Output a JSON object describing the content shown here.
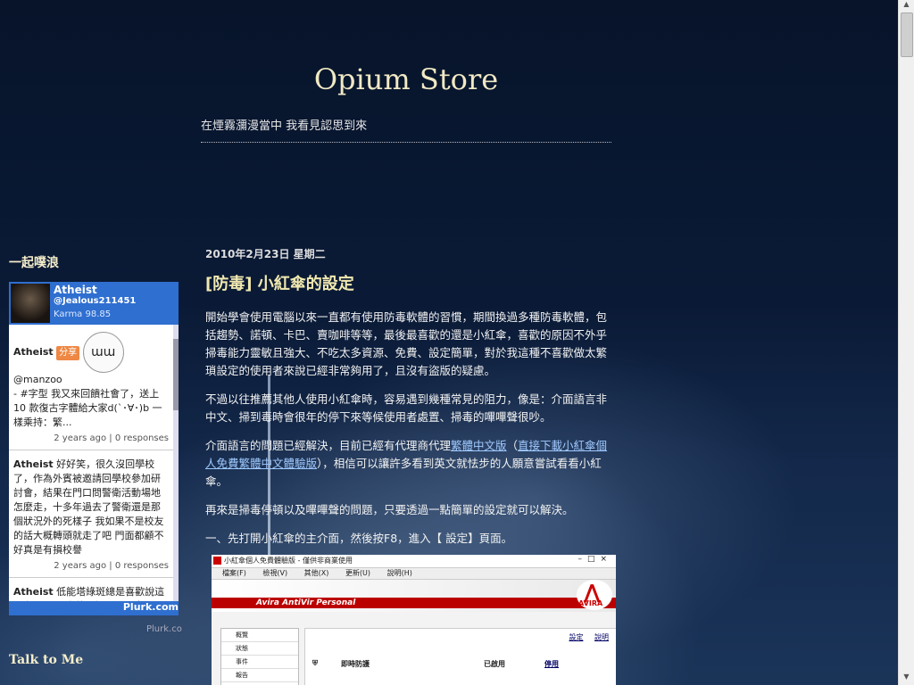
{
  "blog": {
    "title": "Opium Store",
    "description": "在煙霧瀰漫當中 我看見認思到來"
  },
  "sidebar": {
    "plurk_heading": "一起噗浪",
    "talk_heading": "Talk to Me",
    "plurk": {
      "name": "Atheist",
      "handle": "@Jealous211451",
      "karma": "Karma 98.85",
      "footer": "Plurk.com",
      "credit": "Plurk.co",
      "items": [
        {
          "author": "Atheist",
          "share": "分享",
          "mention": "@manzoo",
          "text": "- #字型 我又來回饋社會了，送上 10 款復古字體給大家d(`･∀･)b 一樣乘持：繁...",
          "meta": "2 years ago | 0 responses"
        },
        {
          "author": "Atheist",
          "text": "好好笑，很久沒回學校了，作為外賓被邀請回學校參加研討會，結果在門口問警衛活動場地怎麼走，十多年過去了警衛還是那個狀況外的死樣子 我如果不是校友的話大概轉頭就走了吧 門面都顧不好真是有損校譽",
          "meta": "2 years ago | 0 responses"
        },
        {
          "author": "Atheist",
          "text": "低能塔綠斑總是喜歡說這種台派 民進黨的選擇...反回來...",
          "meta": ""
        }
      ]
    }
  },
  "post": {
    "date": "2010年2月23日 星期二",
    "title": "[防毒] 小紅傘的設定",
    "p1": "開始學會使用電腦以來一直都有使用防毒軟體的習慣，期間換過多種防毒軟體，包括趨勢、諾頓、卡巴、賣咖啡等等，最後最喜歡的還是小紅傘，喜歡的原因不外乎掃毒能力靈敏且強大、不吃太多資源、免費、設定簡單，對於我這種不喜歡做太繁瑣設定的使用者來說已經非常夠用了，且沒有盜版的疑慮。",
    "p2": "不過以往推薦其他人使用小紅傘時，容易遇到幾種常見的阻力，像是：介面語言非中文、掃到毒時會很年的停下來等候使用者處置、掃毒的嗶嗶聲很吵。",
    "p3_a": "介面語言的問題已經解決，目前已經有代理商代理",
    "p3_link1": "繁體中文版",
    "p3_b": "（",
    "p3_link2": "直接下載小紅傘個人免費繁體中文體驗版",
    "p3_c": "），相信可以讓許多看到英文就怯步的人願意嘗試看看小紅傘。",
    "p4": "再來是掃毒停頓以及嗶嗶聲的問題，只要透過一點簡單的設定就可以解決。",
    "p5": "一、先打開小紅傘的主介面，然後按F8，進入【 設定】頁面。"
  },
  "app": {
    "title": "小紅傘個人免費體驗版 - 僅供非商業使用",
    "menu": [
      "檔案(F)",
      "檢視(V)",
      "其他(X)",
      "更新(U)",
      "說明(H)"
    ],
    "brand": "Avira AntiVir Personal",
    "logo_text": "AVIRA",
    "side_items": [
      "概覽",
      "狀態",
      "事件",
      "報告"
    ],
    "links": [
      "設定",
      "說明"
    ],
    "row": {
      "label": "即時防護",
      "status": "已啟用",
      "action": "停用"
    }
  }
}
